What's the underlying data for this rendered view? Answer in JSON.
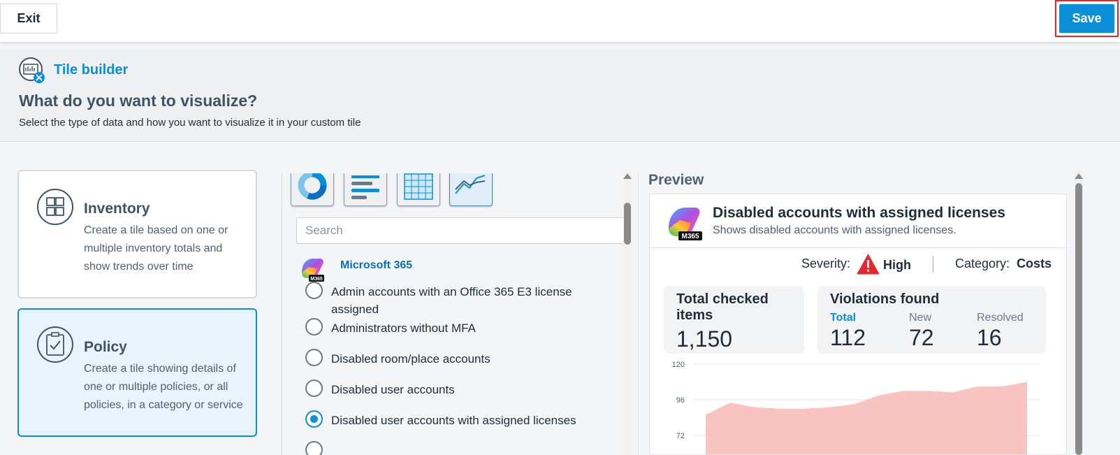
{
  "topbar": {
    "exit_label": "Exit",
    "save_label": "Save"
  },
  "header": {
    "app_title": "Tile builder",
    "heading": "What do you want to visualize?",
    "subheading": "Select the type of data and how you want to visualize it in your custom tile"
  },
  "data_types": [
    {
      "title": "Inventory",
      "description": "Create a tile based on one or multiple inventory totals and show trends over time",
      "icon": "inventory-icon",
      "selected": false
    },
    {
      "title": "Policy",
      "description": "Create a tile showing details of one or multiple policies, or all policies, in a category or service",
      "icon": "policy-icon",
      "selected": true
    }
  ],
  "visualizations": [
    {
      "name": "donut",
      "icon": "donut-chart-icon",
      "selected": false
    },
    {
      "name": "bar",
      "icon": "bar-list-icon",
      "selected": false
    },
    {
      "name": "table",
      "icon": "table-icon",
      "selected": false
    },
    {
      "name": "line",
      "icon": "line-chart-icon",
      "selected": true
    }
  ],
  "search": {
    "placeholder": "Search",
    "value": ""
  },
  "service": {
    "name": "Microsoft 365",
    "badge": "M365"
  },
  "policies": [
    {
      "label": "Admin accounts with an Office 365 E3 license assigned",
      "selected": false
    },
    {
      "label": "Administrators without MFA",
      "selected": false
    },
    {
      "label": "Disabled room/place accounts",
      "selected": false
    },
    {
      "label": "Disabled user accounts",
      "selected": false
    },
    {
      "label": "Disabled user accounts with assigned licenses",
      "selected": true
    }
  ],
  "preview": {
    "label": "Preview",
    "badge": "M365",
    "title": "Disabled accounts with assigned licenses",
    "subtitle": "Shows disabled accounts with assigned licenses.",
    "severity_label": "Severity:",
    "severity_value": "High",
    "category_label": "Category:",
    "category_value": "Costs",
    "total_checked_label": "Total checked items",
    "total_checked_value": "1,150",
    "violations_label": "Violations found",
    "total_label": "Total",
    "total_value": "112",
    "new_label": "New",
    "new_value": "72",
    "resolved_label": "Resolved",
    "resolved_value": "16",
    "colors": {
      "accent": "#0b8fd8",
      "area": "#f9c3c0",
      "high": "#e0282e"
    }
  },
  "chart_data": {
    "type": "area",
    "y_ticks": [
      120,
      96,
      72
    ],
    "ylim": [
      50,
      120
    ],
    "values": [
      86,
      94,
      91,
      90,
      90,
      91,
      93,
      99,
      102,
      102,
      101,
      105,
      105,
      108
    ]
  }
}
